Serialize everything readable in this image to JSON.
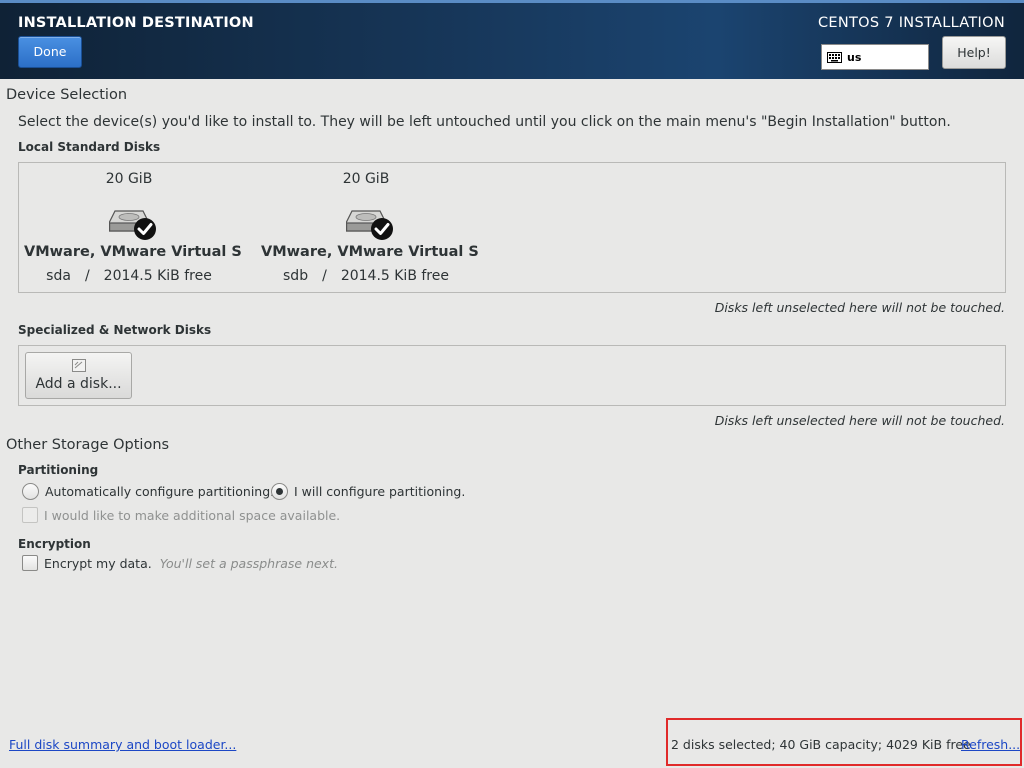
{
  "header": {
    "title": "INSTALLATION DESTINATION",
    "done_label": "Done",
    "product": "CENTOS 7 INSTALLATION",
    "keyboard_layout": "us",
    "help_label": "Help!"
  },
  "device_selection": {
    "heading": "Device Selection",
    "instructions": "Select the device(s) you'd like to install to.  They will be left untouched until you click on the main menu's \"Begin Installation\" button.",
    "local_heading": "Local Standard Disks",
    "disks": [
      {
        "size": "20 GiB",
        "name": "VMware, VMware Virtual S",
        "device": "sda",
        "separator": "/",
        "free": "2014.5 KiB free",
        "selected": true
      },
      {
        "size": "20 GiB",
        "name": "VMware, VMware Virtual S",
        "device": "sdb",
        "separator": "/",
        "free": "2014.5 KiB free",
        "selected": true
      }
    ],
    "local_note": "Disks left unselected here will not be touched.",
    "specialized_heading": "Specialized & Network Disks",
    "add_disk_label": "Add a disk...",
    "specialized_note": "Disks left unselected here will not be touched."
  },
  "other_storage": {
    "heading": "Other Storage Options",
    "partitioning_heading": "Partitioning",
    "auto_label": "Automatically configure partitioning.",
    "manual_label": "I will configure partitioning.",
    "selected_option": "manual",
    "space_label": "I would like to make additional space available.",
    "encryption_heading": "Encryption",
    "encrypt_label": "Encrypt my data.",
    "encrypt_hint": "You'll set a passphrase next."
  },
  "footer": {
    "summary_link": "Full disk summary and boot loader...",
    "status": "2 disks selected; 40 GiB capacity; 4029 KiB free",
    "refresh_link": "Refresh..."
  },
  "colors": {
    "accent": "#2c6fc7",
    "link": "#1c47c5",
    "highlight_box": "#e02a2a"
  }
}
